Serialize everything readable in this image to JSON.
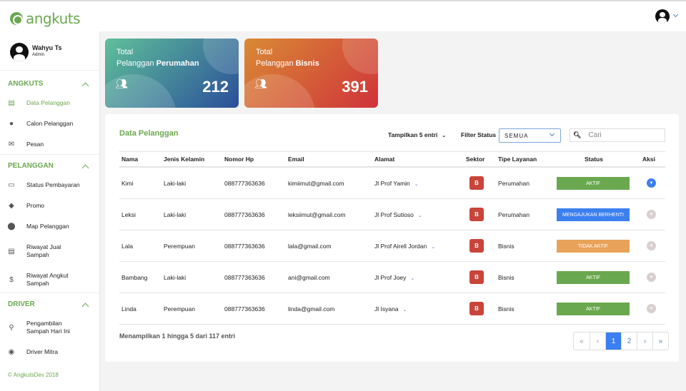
{
  "brand": "angkuts",
  "user": {
    "name": "Wahyu Ts",
    "role": "Admin"
  },
  "sidebar": {
    "sections": [
      {
        "title": "ANGKUTS",
        "items": [
          {
            "label": "Data Pelanggan",
            "icon": "id-card-icon"
          },
          {
            "label": "Calon Pelanggan",
            "icon": "user-icon"
          },
          {
            "label": "Pesan",
            "icon": "envelope-icon"
          }
        ]
      },
      {
        "title": "PELANGGAN",
        "items": [
          {
            "label": "Status Pembayaran",
            "icon": "credit-card-icon"
          },
          {
            "label": "Promo",
            "icon": "tag-icon"
          },
          {
            "label": "Map Pelanggan",
            "icon": "map-marker-icon"
          },
          {
            "label": "Riwayat Jual Sampah",
            "icon": "id-card-icon"
          },
          {
            "label": "Riwayat Angkut Sampah",
            "icon": "dollar-icon"
          }
        ]
      },
      {
        "title": "DRIVER",
        "items": [
          {
            "label": "Pengambilan Sampah Hari Ini",
            "icon": "bicycle-icon"
          },
          {
            "label": "Driver Mitra",
            "icon": "user-circle-icon"
          }
        ]
      }
    ],
    "footer": "© AngkutsDev 2018"
  },
  "cards": [
    {
      "line1": "Total",
      "line2a": "Pelanggan ",
      "line2b": "Perumahan",
      "value": "212",
      "gradient": [
        "#5fbf9a",
        "#2b4f9a"
      ]
    },
    {
      "line1": "Total",
      "line2a": "Pelanggan ",
      "line2b": "Bisnis",
      "value": "391",
      "gradient": [
        "#d98a35",
        "#d0343a"
      ]
    }
  ],
  "panel": {
    "title": "Data Pelanggan",
    "show_entries": "Tampilkan 5 entri",
    "filter_label": "Filter Status",
    "filter_value": "SEMUA",
    "search_placeholder": "Cari",
    "columns": [
      "Nama",
      "Jenis Kelamin",
      "Nomor Hp",
      "Email",
      "Alamat",
      "Sektor",
      "Tipe Layanan",
      "Status",
      "Aksi"
    ],
    "rows": [
      {
        "nama": "Kimi",
        "jk": "Laki-laki",
        "hp": "088777363636",
        "email": "kimiimut@gmail.com",
        "alamat": "Jl Prof Yamin",
        "sektor": "B",
        "tipe": "Perumahan",
        "status": "AKTIF",
        "status_color": "#6aa84f",
        "aksi_active": true
      },
      {
        "nama": "Leksi",
        "jk": "Laki-laki",
        "hp": "088777363636",
        "email": "leksiimut@gmail.com",
        "alamat": "Jl Prof Sutioso",
        "sektor": "B",
        "tipe": "Perumahan",
        "status": "MENGAJUKAN BERHENTI",
        "status_color": "#3b7ff0",
        "aksi_active": false
      },
      {
        "nama": "Lala",
        "jk": "Perempuan",
        "hp": "088777363636",
        "email": "lala@gmail.com",
        "alamat": "Jl Prof Airell Jordan",
        "sektor": "B",
        "tipe": "Bisnis",
        "status": "TIDAK AKTIF",
        "status_color": "#e8a25a",
        "aksi_active": false
      },
      {
        "nama": "Bambang",
        "jk": "Laki-laki",
        "hp": "088777363636",
        "email": "ani@gmail.com",
        "alamat": "Jl Prof Joey",
        "sektor": "B",
        "tipe": "Bisnis",
        "status": "AKTIF",
        "status_color": "#6aa84f",
        "aksi_active": false
      },
      {
        "nama": "Linda",
        "jk": "Perempuan",
        "hp": "088777363636",
        "email": "linda@gmail.com",
        "alamat": "Jl Isyana",
        "sektor": "B",
        "tipe": "Bisnis",
        "status": "AKTIF",
        "status_color": "#6aa84f",
        "aksi_active": false
      }
    ],
    "info": "Menampilkan 1 hingga 5 dari 117 entri",
    "pagination": [
      "«",
      "‹",
      "1",
      "2",
      "›",
      "»"
    ],
    "current_page": "1"
  }
}
